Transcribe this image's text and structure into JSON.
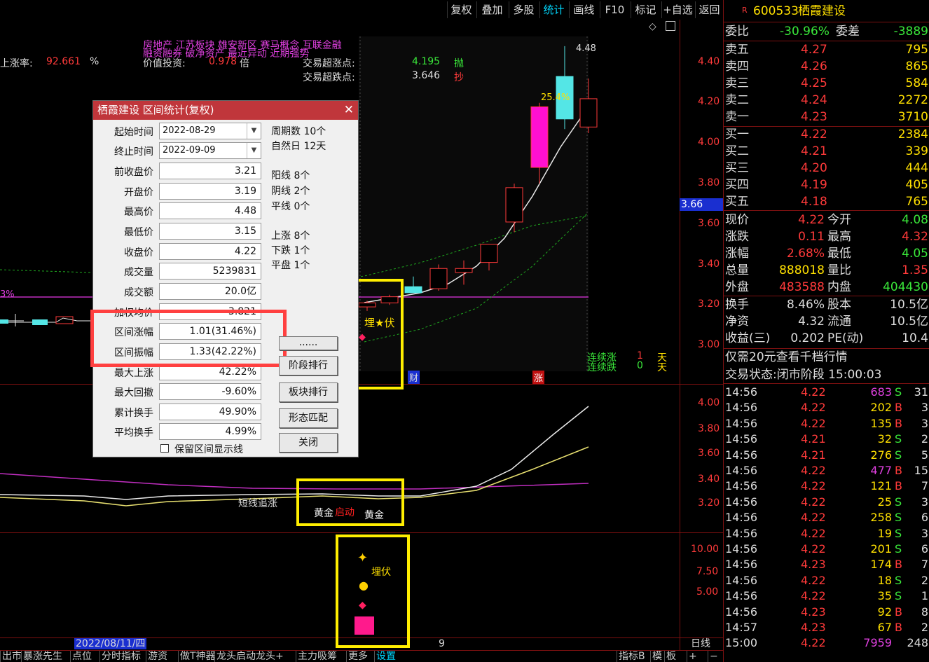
{
  "toolbar": {
    "buttons": [
      "复权",
      "叠加",
      "多股",
      "统计",
      "画线",
      "F10",
      "标记",
      "+自选",
      "返回"
    ],
    "active": "统计"
  },
  "overlay": {
    "tags_line1": "房地产      江苏板块     雄安新区 赛马概念 互联金融",
    "tags_line2": "融资融券 破净资产 最近异动 近期强势",
    "rise_rate_label": "上涨率:",
    "rise_rate_value": "92.661",
    "rise_rate_unit": "%",
    "value_label": "价值投资:",
    "value_value": "0.978",
    "value_unit": "倍",
    "over_rise_label": "交易超涨点:",
    "over_rise_value": "4.195",
    "over_rise_tag": "抛",
    "over_fall_label": "交易超跌点:",
    "over_fall_value": "3.646",
    "over_fall_tag": "抄",
    "left_pct": "3%",
    "high_mark": "4.48",
    "pct_label": "25.4%",
    "buy_signal": "埋★伏",
    "mark_cai": "财",
    "mark_zhang": "涨",
    "consecutive_up_label": "连续涨",
    "consecutive_up_value": "1",
    "consecutive_up_unit": "天",
    "consecutive_down_label": "连续跌",
    "consecutive_down_value": "0",
    "consecutive_down_unit": "天",
    "price_tag": "3.66",
    "sub_label_short": "短线追涨",
    "sub_label_gold1": "黄金",
    "sub_label_start": "启动",
    "sub_label_gold2": "黄金",
    "bottom_signal": "埋伏",
    "date_left": "2022/08/11/四",
    "date_mid": "9",
    "period": "日线"
  },
  "axes": {
    "main": [
      "4.40",
      "4.20",
      "4.00",
      "3.80",
      "3.60",
      "3.40",
      "3.20",
      "3.00"
    ],
    "sub1": [
      "4.00",
      "3.80",
      "3.60",
      "3.40",
      "3.20"
    ],
    "sub2": [
      "10.00",
      "7.50",
      "5.00"
    ]
  },
  "chart_data": {
    "type": "candlestick",
    "candles": [
      {
        "o": 3.19,
        "h": 3.22,
        "l": 3.17,
        "c": 3.21
      },
      {
        "o": 3.21,
        "h": 3.25,
        "l": 3.2,
        "c": 3.24
      },
      {
        "o": 3.29,
        "h": 3.34,
        "l": 3.26,
        "c": 3.26
      },
      {
        "o": 3.28,
        "h": 3.4,
        "l": 3.27,
        "c": 3.38
      },
      {
        "o": 3.36,
        "h": 3.42,
        "l": 3.3,
        "c": 3.38
      },
      {
        "o": 3.41,
        "h": 3.5,
        "l": 3.37,
        "c": 3.5
      },
      {
        "o": 3.61,
        "h": 3.8,
        "l": 3.56,
        "c": 3.78
      },
      {
        "o": 3.88,
        "h": 4.2,
        "l": 3.8,
        "c": 4.18
      },
      {
        "o": 4.33,
        "h": 4.48,
        "l": 4.07,
        "c": 4.12
      },
      {
        "o": 4.08,
        "h": 4.32,
        "l": 4.05,
        "c": 4.22
      }
    ]
  },
  "dialog": {
    "title": "栖霞建设 区间统计(复权)",
    "start_label": "起始时间",
    "start_value": "2022-08-29",
    "end_label": "终止时间",
    "end_value": "2022-09-09",
    "fields": [
      {
        "label": "前收盘价",
        "value": "3.21"
      },
      {
        "label": "开盘价",
        "value": "3.19"
      },
      {
        "label": "最高价",
        "value": "4.48"
      },
      {
        "label": "最低价",
        "value": "3.15"
      },
      {
        "label": "收盘价",
        "value": "4.22"
      },
      {
        "label": "成交量",
        "value": "5239831"
      },
      {
        "label": "成交额",
        "value": "20.0亿"
      },
      {
        "label": "加权均价",
        "value": "3.821"
      },
      {
        "label": "区间涨幅",
        "value": "1.01(31.46%)"
      },
      {
        "label": "区间振幅",
        "value": "1.33(42.22%)"
      },
      {
        "label": "最大上涨",
        "value": "42.22%"
      },
      {
        "label": "最大回撤",
        "value": "-9.60%"
      },
      {
        "label": "累计换手",
        "value": "49.90%"
      },
      {
        "label": "平均换手",
        "value": "4.99%"
      }
    ],
    "period_count": "周期数 10个",
    "natural_days": "自然日 12天",
    "yang": "阳线 8个",
    "yin": "阴线 2个",
    "flat": "平线 0个",
    "up": "上涨 8个",
    "down": "下跌 1个",
    "level": "平盘 1个",
    "btn_more": "......",
    "btn_stage": "阶段排行",
    "btn_sector": "板块排行",
    "btn_pattern": "形态匹配",
    "btn_close": "关闭",
    "checkbox": "保留区间显示线"
  },
  "quote": {
    "code": "600533",
    "name": "栖霞建设",
    "weibi_label": "委比",
    "weibi": "-30.96%",
    "weicha_label": "委差",
    "weicha": "-3889",
    "asks": [
      {
        "label": "卖五",
        "price": "4.27",
        "vol": "795"
      },
      {
        "label": "卖四",
        "price": "4.26",
        "vol": "865"
      },
      {
        "label": "卖三",
        "price": "4.25",
        "vol": "584"
      },
      {
        "label": "卖二",
        "price": "4.24",
        "vol": "2272"
      },
      {
        "label": "卖一",
        "price": "4.23",
        "vol": "3710"
      }
    ],
    "bids": [
      {
        "label": "买一",
        "price": "4.22",
        "vol": "2384"
      },
      {
        "label": "买二",
        "price": "4.21",
        "vol": "339"
      },
      {
        "label": "买三",
        "price": "4.20",
        "vol": "444"
      },
      {
        "label": "买四",
        "price": "4.19",
        "vol": "405"
      },
      {
        "label": "买五",
        "price": "4.18",
        "vol": "765"
      }
    ],
    "stats": [
      {
        "l1": "现价",
        "v1": "4.22",
        "l2": "今开",
        "v2": "4.08"
      },
      {
        "l1": "涨跌",
        "v1": "0.11",
        "l2": "最高",
        "v2": "4.32"
      },
      {
        "l1": "涨幅",
        "v1": "2.68%",
        "l2": "最低",
        "v2": "4.05"
      },
      {
        "l1": "总量",
        "v1": "888018",
        "l2": "量比",
        "v2": "1.35"
      },
      {
        "l1": "外盘",
        "v1": "483588",
        "l2": "内盘",
        "v2": "404430"
      }
    ],
    "stats2": [
      {
        "l1": "换手",
        "v1": "8.46%",
        "l2": "股本",
        "v2": "10.5亿"
      },
      {
        "l1": "净资",
        "v1": "4.32",
        "l2": "流通",
        "v2": "10.5亿"
      },
      {
        "l1": "收益(三)",
        "v1": "0.202",
        "l2": "PE(动)",
        "v2": "10.4"
      }
    ],
    "notice": "仅需20元查看千档行情",
    "status": "交易状态:闭市阶段 15:00:03",
    "ticks": [
      {
        "t": "14:56",
        "p": "4.22",
        "v": "683",
        "s": "S",
        "n": "31"
      },
      {
        "t": "14:56",
        "p": "4.22",
        "v": "202",
        "s": "B",
        "n": "3"
      },
      {
        "t": "14:56",
        "p": "4.22",
        "v": "135",
        "s": "B",
        "n": "3"
      },
      {
        "t": "14:56",
        "p": "4.21",
        "v": "32",
        "s": "S",
        "n": "2"
      },
      {
        "t": "14:56",
        "p": "4.21",
        "v": "276",
        "s": "S",
        "n": "5"
      },
      {
        "t": "14:56",
        "p": "4.22",
        "v": "477",
        "s": "B",
        "n": "15"
      },
      {
        "t": "14:56",
        "p": "4.22",
        "v": "121",
        "s": "B",
        "n": "7"
      },
      {
        "t": "14:56",
        "p": "4.22",
        "v": "25",
        "s": "S",
        "n": "3"
      },
      {
        "t": "14:56",
        "p": "4.22",
        "v": "258",
        "s": "S",
        "n": "6"
      },
      {
        "t": "14:56",
        "p": "4.22",
        "v": "19",
        "s": "S",
        "n": "3"
      },
      {
        "t": "14:56",
        "p": "4.22",
        "v": "201",
        "s": "S",
        "n": "6"
      },
      {
        "t": "14:56",
        "p": "4.23",
        "v": "174",
        "s": "B",
        "n": "7"
      },
      {
        "t": "14:56",
        "p": "4.22",
        "v": "18",
        "s": "S",
        "n": "2"
      },
      {
        "t": "14:56",
        "p": "4.22",
        "v": "35",
        "s": "S",
        "n": "1"
      },
      {
        "t": "14:56",
        "p": "4.23",
        "v": "92",
        "s": "B",
        "n": "8"
      },
      {
        "t": "14:57",
        "p": "4.23",
        "v": "67",
        "s": "B",
        "n": "2"
      },
      {
        "t": "15:00",
        "p": "4.22",
        "v": "7959",
        "s": "",
        "n": "248"
      }
    ]
  },
  "bottom_tabs": [
    "出市",
    "暴涨先生",
    "点位",
    "分时指标",
    "游资",
    "做T神器",
    "龙头启动龙头+",
    "主力吸筹",
    "更多",
    "设置"
  ],
  "bottom_right": [
    "指标B",
    "模",
    "板",
    "+",
    "−"
  ]
}
